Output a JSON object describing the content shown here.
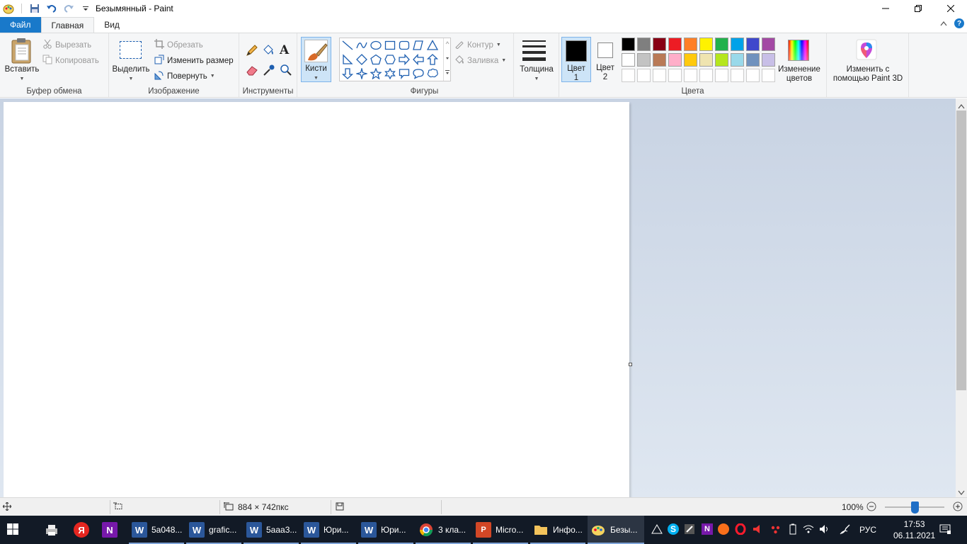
{
  "window": {
    "title": "Безымянный - Paint"
  },
  "tabs": {
    "file": "Файл",
    "home": "Главная",
    "view": "Вид"
  },
  "clipboard": {
    "paste": "Вставить",
    "cut": "Вырезать",
    "copy": "Копировать",
    "label": "Буфер обмена"
  },
  "image": {
    "select": "Выделить",
    "crop": "Обрезать",
    "resize": "Изменить размер",
    "rotate": "Повернуть",
    "label": "Изображение"
  },
  "tools": {
    "label": "Инструменты"
  },
  "brushes": {
    "label": "Кисти"
  },
  "shapes": {
    "outline": "Контур",
    "fill": "Заливка",
    "label": "Фигуры"
  },
  "size": {
    "label": "Толщина"
  },
  "colors": {
    "color1_line1": "Цвет",
    "color1_line2": "1",
    "color2_line1": "Цвет",
    "color2_line2": "2",
    "edit_line1": "Изменение",
    "edit_line2": "цветов",
    "label": "Цвета",
    "color1": "#000000",
    "color2": "#ffffff",
    "palette_row1": [
      "#000000",
      "#7f7f7f",
      "#880015",
      "#ed1c24",
      "#ff7f27",
      "#fff200",
      "#22b14c",
      "#00a2e8",
      "#3f48cc",
      "#a349a4"
    ],
    "palette_row2": [
      "#ffffff",
      "#c3c3c3",
      "#b97a57",
      "#ffaec9",
      "#ffc90e",
      "#efe4b0",
      "#b5e61d",
      "#99d9ea",
      "#7092be",
      "#c8bfe7"
    ]
  },
  "paint3d": {
    "line1": "Изменить с",
    "line2": "помощью Paint 3D"
  },
  "status": {
    "dimensions": "884 × 742пкс",
    "zoom": "100%"
  },
  "taskbar": {
    "items": [
      {
        "label": "5a048..."
      },
      {
        "label": "grafic..."
      },
      {
        "label": "5aaa3..."
      },
      {
        "label": "Юри..."
      },
      {
        "label": "Юри..."
      },
      {
        "label": "3 кла..."
      },
      {
        "label": "Micro..."
      },
      {
        "label": "Инфо..."
      },
      {
        "label": "Безы..."
      }
    ],
    "language": "РУС",
    "time": "17:53",
    "date": "06.11.2021"
  }
}
